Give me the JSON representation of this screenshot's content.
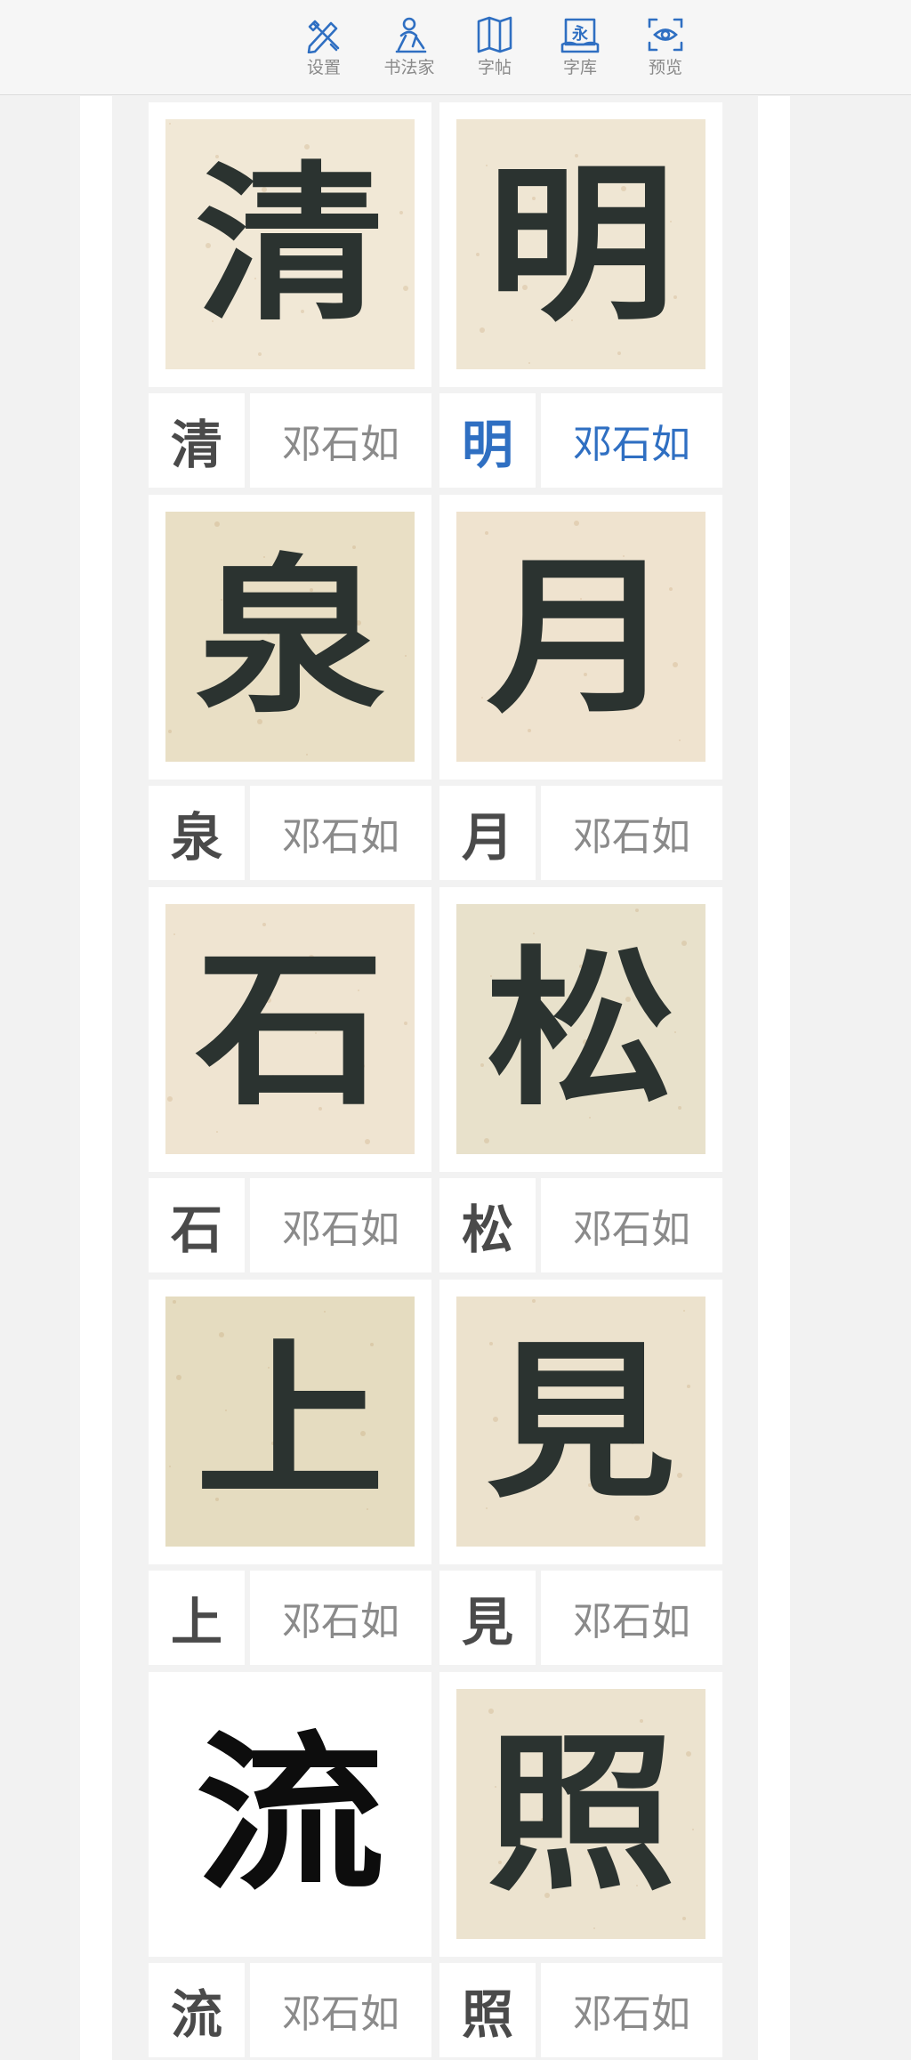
{
  "toolbar": {
    "items": [
      {
        "label": "设置",
        "icon": "brush-ruler-icon"
      },
      {
        "label": "书法家",
        "icon": "calligrapher-icon"
      },
      {
        "label": "字帖",
        "icon": "book-map-icon"
      },
      {
        "label": "字库",
        "icon": "character-library-icon"
      },
      {
        "label": "预览",
        "icon": "eye-preview-icon"
      }
    ],
    "library_icon_glyph": "永",
    "accent_color": "#2f6fc2"
  },
  "cards": [
    {
      "char": "清",
      "author": "邓石如",
      "selected": false,
      "paper": "#f1e8d6"
    },
    {
      "char": "明",
      "author": "邓石如",
      "selected": true,
      "paper": "#efe6d3"
    },
    {
      "char": "泉",
      "author": "邓石如",
      "selected": false,
      "paper": "#e9dfc5"
    },
    {
      "char": "月",
      "author": "邓石如",
      "selected": false,
      "paper": "#efe3cf"
    },
    {
      "char": "石",
      "author": "邓石如",
      "selected": false,
      "paper": "#efe4d1"
    },
    {
      "char": "松",
      "author": "邓石如",
      "selected": false,
      "paper": "#e8e1cb"
    },
    {
      "char": "上",
      "author": "邓石如",
      "selected": false,
      "paper": "#e5dcc0"
    },
    {
      "char": "見",
      "author": "邓石如",
      "selected": false,
      "paper": "#ece2cd"
    },
    {
      "char": "流",
      "author": "邓石如",
      "selected": false,
      "paper": "#ffffff"
    },
    {
      "char": "照",
      "author": "邓石如",
      "selected": false,
      "paper": "#ece3cf"
    }
  ]
}
